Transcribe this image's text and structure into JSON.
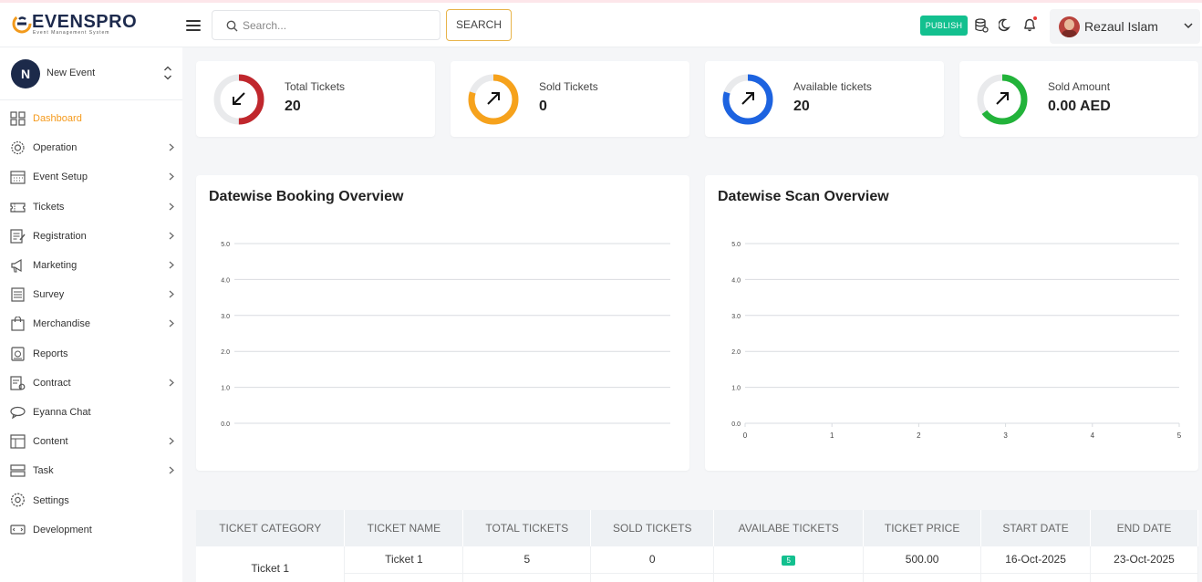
{
  "header": {
    "brand": "EVENSPRO",
    "tagline": "Event Management System",
    "search_placeholder": "Search...",
    "search_button": "SEARCH",
    "publish_label": "PUBLISH",
    "user_name": "Rezaul Islam"
  },
  "sidebar": {
    "event_initial": "N",
    "event_name": "New Event",
    "items": [
      {
        "label": "Dashboard",
        "icon": "grid-icon",
        "active": true,
        "has_children": false
      },
      {
        "label": "Operation",
        "icon": "gear-icon",
        "active": false,
        "has_children": true
      },
      {
        "label": "Event Setup",
        "icon": "calendar-icon",
        "active": false,
        "has_children": true
      },
      {
        "label": "Tickets",
        "icon": "ticket-icon",
        "active": false,
        "has_children": true
      },
      {
        "label": "Registration",
        "icon": "form-icon",
        "active": false,
        "has_children": true
      },
      {
        "label": "Marketing",
        "icon": "megaphone-icon",
        "active": false,
        "has_children": true
      },
      {
        "label": "Survey",
        "icon": "survey-icon",
        "active": false,
        "has_children": true
      },
      {
        "label": "Merchandise",
        "icon": "bag-icon",
        "active": false,
        "has_children": true
      },
      {
        "label": "Reports",
        "icon": "report-icon",
        "active": false,
        "has_children": false
      },
      {
        "label": "Contract",
        "icon": "contract-icon",
        "active": false,
        "has_children": true
      },
      {
        "label": "Eyanna Chat",
        "icon": "chat-icon",
        "active": false,
        "has_children": false
      },
      {
        "label": "Content",
        "icon": "content-icon",
        "active": false,
        "has_children": true
      },
      {
        "label": "Task",
        "icon": "task-icon",
        "active": false,
        "has_children": true
      },
      {
        "label": "Settings",
        "icon": "settings-icon",
        "active": false,
        "has_children": false
      },
      {
        "label": "Development",
        "icon": "development-icon",
        "active": false,
        "has_children": false
      }
    ]
  },
  "stats": [
    {
      "label": "Total Tickets",
      "value": "20",
      "color": "#c0272d",
      "fill": 0.5,
      "arrow": "down-left"
    },
    {
      "label": "Sold Tickets",
      "value": "0",
      "color": "#f6a21c",
      "fill": 0.8,
      "arrow": "up-right"
    },
    {
      "label": "Available tickets",
      "value": "20",
      "color": "#1d63e0",
      "fill": 0.8,
      "arrow": "up-right"
    },
    {
      "label": "Sold Amount",
      "value": "0.00 AED",
      "color": "#22b33a",
      "fill": 0.65,
      "arrow": "up-right"
    }
  ],
  "chart_data": [
    {
      "type": "line",
      "title": "Datewise Booking Overview",
      "y_ticks": [
        "5.0",
        "4.0",
        "3.0",
        "2.0",
        "1.0",
        "0.0"
      ],
      "ylim": [
        0,
        5
      ],
      "x_ticks": [],
      "series": []
    },
    {
      "type": "line",
      "title": "Datewise Scan Overview",
      "y_ticks": [
        "5.0",
        "4.0",
        "3.0",
        "2.0",
        "1.0",
        "0.0"
      ],
      "ylim": [
        0,
        5
      ],
      "x_ticks": [
        "0",
        "1",
        "2",
        "3",
        "4",
        "5"
      ],
      "xlim": [
        0,
        5
      ],
      "series": []
    }
  ],
  "table": {
    "headers": [
      "TICKET CATEGORY",
      "TICKET NAME",
      "TOTAL TICKETS",
      "SOLD TICKETS",
      "AVAILABE TICKETS",
      "TICKET PRICE",
      "START DATE",
      "END DATE"
    ],
    "category": "Ticket 1",
    "rows": [
      {
        "name": "Ticket 1",
        "total": "5",
        "sold": "0",
        "available": "5",
        "price": "500.00",
        "start": "16-Oct-2025",
        "end": "23-Oct-2025"
      }
    ]
  }
}
